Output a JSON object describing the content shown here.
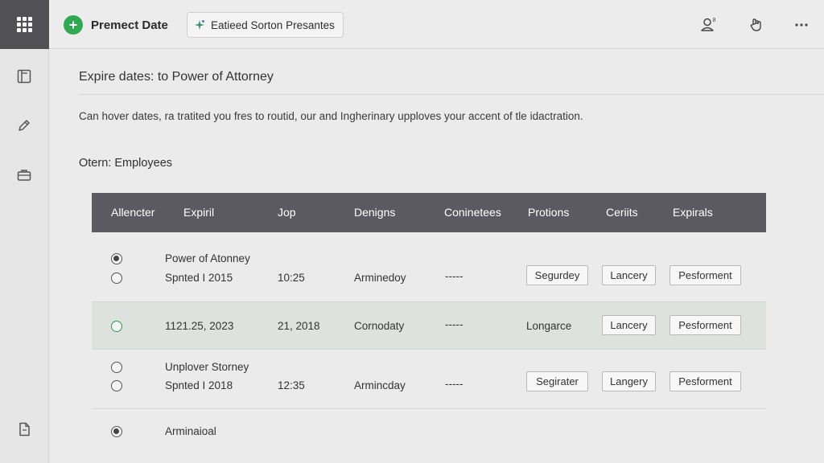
{
  "topbar": {
    "app_title": "Premect Date",
    "workspace_chip": "Eatieed Sorton Presantes",
    "user_badge": "8"
  },
  "page": {
    "title": "Expire dates: to Power of Attorney",
    "description": "Can hover dates, ra tratited you fres to routid, our and Ingherinary upploves your accent of tle idactration.",
    "section_title": "Otern: Employees"
  },
  "table": {
    "headers": [
      "Allencter",
      "Expiril",
      "Jop",
      "Denigns",
      "Coninetees",
      "Protions",
      "Ceriits",
      "Expirals"
    ],
    "rows": [
      {
        "title_line": "Power of Atonney",
        "date": "Spnted I 2015",
        "jop": "10:25",
        "designs": "Arminedoy",
        "committees": "-----",
        "protions": "Segurdey",
        "credits": "Lancery",
        "expirals": "Pesforment"
      },
      {
        "date": "1121.25, 2023",
        "jop": "21, 2018",
        "designs": "Cornodaty",
        "committees": "-----",
        "protions": "Longarce",
        "credits": "Lancery",
        "expirals": "Pesforment"
      },
      {
        "title_line": "Unplover Storney",
        "date": "Spnted I 2018",
        "jop": "12:35",
        "designs": "Armincday",
        "committees": "-----",
        "protions": "Segirater",
        "credits": "Langery",
        "expirals": "Pesforment"
      },
      {
        "label": "Arminaioal"
      }
    ]
  },
  "colors": {
    "accent_green": "#2faa53",
    "header_dark": "#5a5a60",
    "rail_top": "#505055"
  },
  "icons": {
    "rail": [
      "apps-grid-icon",
      "panel-icon",
      "pen-icon",
      "briefcase-icon",
      "document-icon"
    ],
    "topbar": [
      "plus-icon",
      "sparkle-icon",
      "user-icon",
      "hand-icon",
      "more-icon"
    ]
  }
}
